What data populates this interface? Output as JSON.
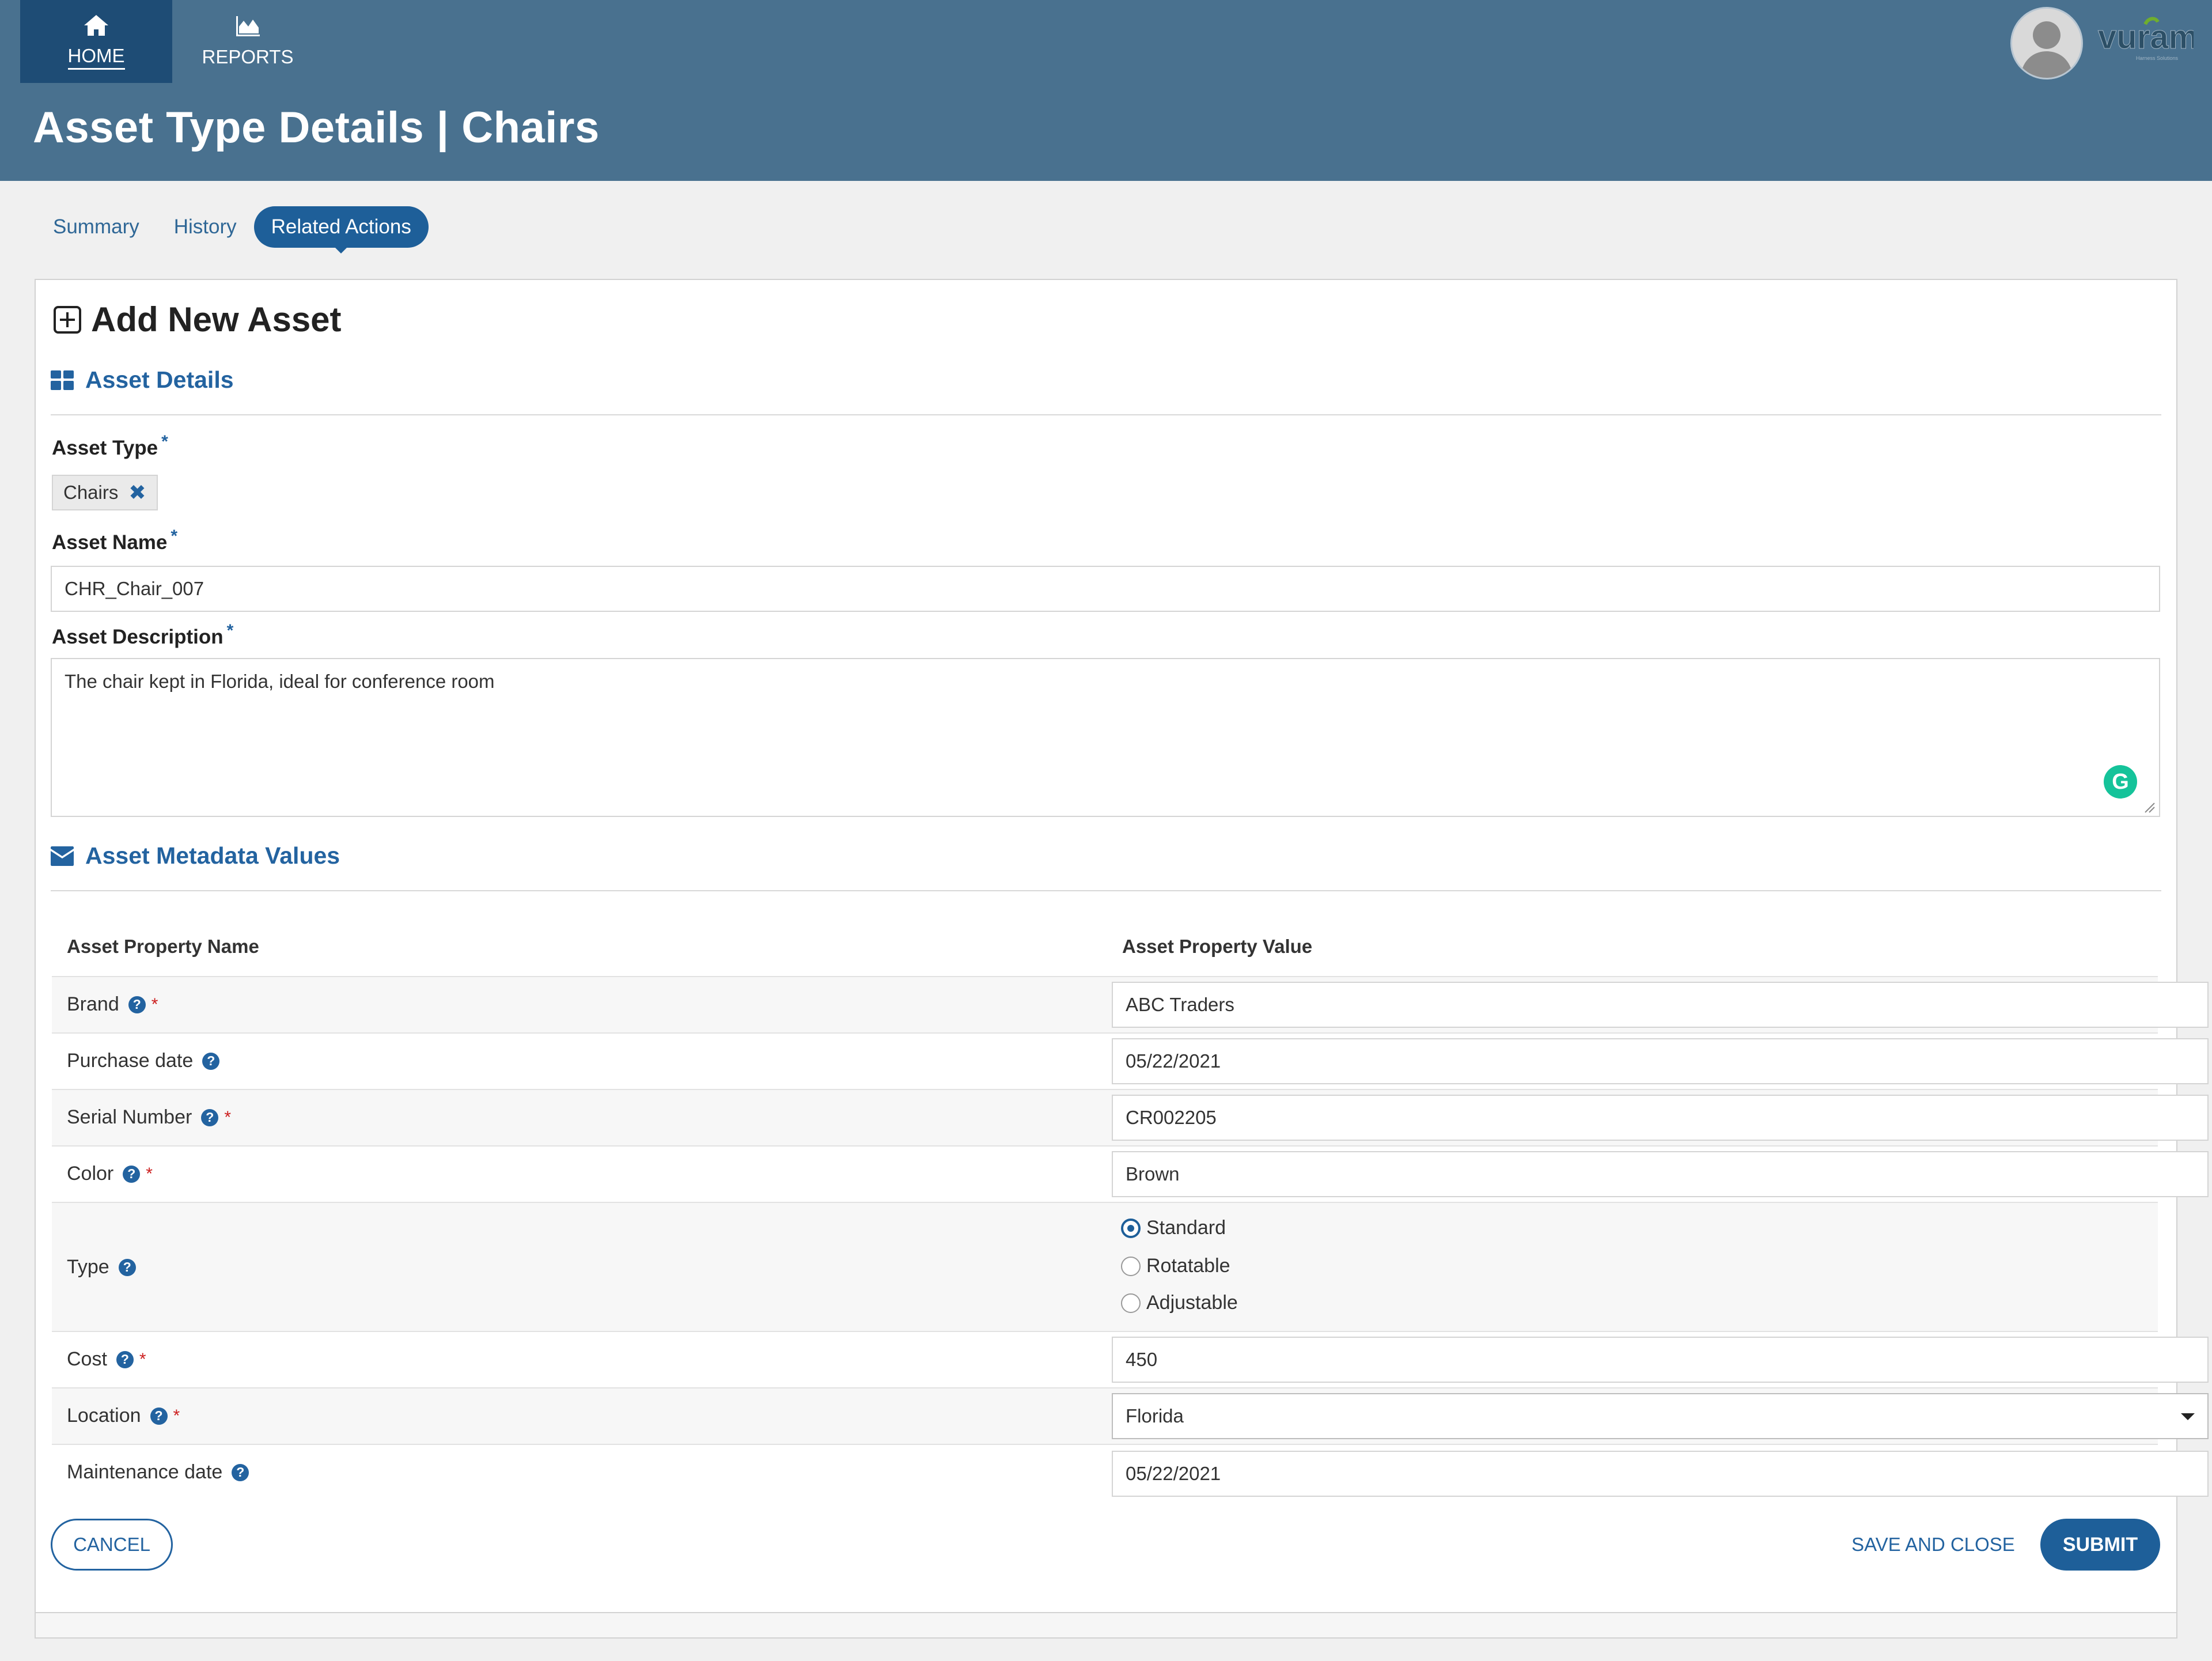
{
  "nav": {
    "home_label": "HOME",
    "reports_label": "REPORTS"
  },
  "header": {
    "title": "Asset Type Details | Chairs",
    "logo_text": "vuram"
  },
  "tabs": [
    {
      "label": "Summary",
      "active": false
    },
    {
      "label": "History",
      "active": false
    },
    {
      "label": "Related Actions",
      "active": true
    }
  ],
  "form": {
    "title": "Add New Asset",
    "asset_details_heading": "Asset Details",
    "asset_type_label": "Asset Type",
    "asset_type_value": "Chairs",
    "asset_name_label": "Asset Name",
    "asset_name_value": "CHR_Chair_007",
    "asset_description_label": "Asset Description",
    "asset_description_value": "The chair kept in Florida, ideal for conference room",
    "required_mark": "*",
    "metadata_heading": "Asset  Metadata Values"
  },
  "metadata": {
    "col_name": "Asset Property Name",
    "col_value": "Asset Property Value",
    "rows": [
      {
        "name": "Brand",
        "required": true,
        "value": "ABC Traders"
      },
      {
        "name": "Purchase date",
        "required": false,
        "value": "05/22/2021"
      },
      {
        "name": "Serial Number",
        "required": true,
        "value": "CR002205"
      },
      {
        "name": "Color",
        "required": true,
        "value": "Brown"
      },
      {
        "name": "Type",
        "required": false,
        "options": [
          "Standard",
          "Rotatable",
          "Adjustable"
        ],
        "selected": "Standard"
      },
      {
        "name": "Cost",
        "required": true,
        "value": "450"
      },
      {
        "name": "Location",
        "required": true,
        "value": "Florida"
      },
      {
        "name": "Maintenance date",
        "required": false,
        "value": "05/22/2021"
      }
    ]
  },
  "actions": {
    "cancel": "CANCEL",
    "save_close": "SAVE AND CLOSE",
    "submit": "SUBMIT"
  },
  "colors": {
    "header_bg": "#49718f",
    "nav_active_bg": "#1e4c75",
    "accent": "#1e5f99",
    "required_red": "#cc1f1f",
    "grammarly": "#15c39a"
  },
  "icons": {
    "home": "home-icon",
    "reports": "area-chart-icon",
    "add": "plus-square-icon",
    "details": "dashboard-grid-icon",
    "metadata": "envelope-icon",
    "help": "question-circle-icon",
    "remove": "times-icon"
  }
}
